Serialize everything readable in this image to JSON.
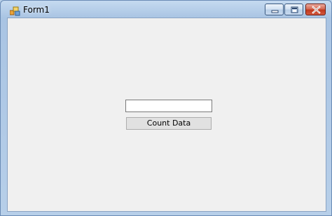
{
  "window": {
    "title": "Form1",
    "icon": "app-form-icon",
    "controls": {
      "minimize_icon": "minimize-icon",
      "maximize_icon": "restore-icon",
      "close_icon": "close-icon"
    }
  },
  "form": {
    "input_value": "",
    "count_button_label": "Count Data"
  },
  "colors": {
    "client_background": "#f0f0f0",
    "titlebar": "#b9d1ea",
    "close_button": "#c0391f"
  }
}
